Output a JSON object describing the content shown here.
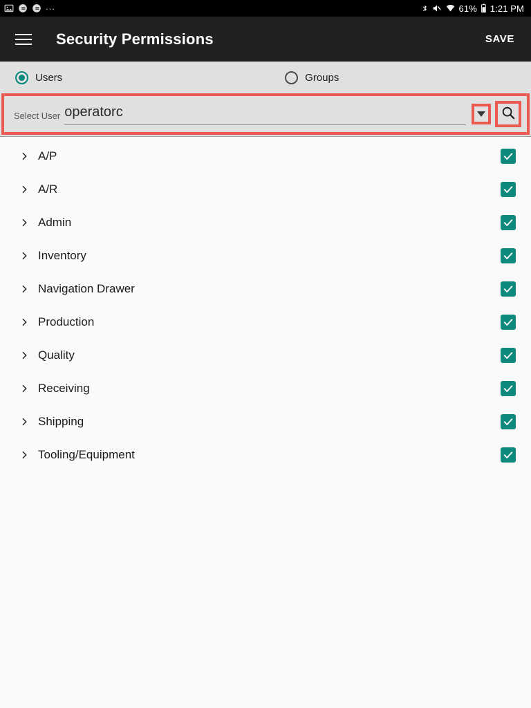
{
  "status_bar": {
    "left_icons": [
      "image-icon",
      "notification-app-icon",
      "notification-app-icon",
      "more-notifications-ellipsis"
    ],
    "ellipsis": "...",
    "right_icons": [
      "bluetooth-icon",
      "volume-off-icon",
      "wifi-icon",
      "battery-icon"
    ],
    "battery_percent": "61%",
    "time": "1:21 PM"
  },
  "app_bar": {
    "menu_icon": "hamburger-menu-icon",
    "title": "Security Permissions",
    "save_label": "SAVE"
  },
  "selector": {
    "radios": [
      {
        "label": "Users",
        "selected": true
      },
      {
        "label": "Groups",
        "selected": false
      }
    ],
    "select_user": {
      "label": "Select User",
      "value": "operatorc",
      "dropdown_icon": "caret-down-icon",
      "search_icon": "search-icon"
    }
  },
  "permissions": {
    "rows": [
      {
        "label": "A/P",
        "checked": true
      },
      {
        "label": "A/R",
        "checked": true
      },
      {
        "label": "Admin",
        "checked": true
      },
      {
        "label": "Inventory",
        "checked": true
      },
      {
        "label": "Navigation Drawer",
        "checked": true
      },
      {
        "label": "Production",
        "checked": true
      },
      {
        "label": "Quality",
        "checked": true
      },
      {
        "label": "Receiving",
        "checked": true
      },
      {
        "label": "Shipping",
        "checked": true
      },
      {
        "label": "Tooling/Equipment",
        "checked": true
      }
    ]
  },
  "colors": {
    "accent_teal": "#00897B",
    "checkbox_teal": "#0d8a7d",
    "appbar_dark": "#212121",
    "panel_gray": "#e0e0e0",
    "annotation_red": "#ea5a52"
  }
}
